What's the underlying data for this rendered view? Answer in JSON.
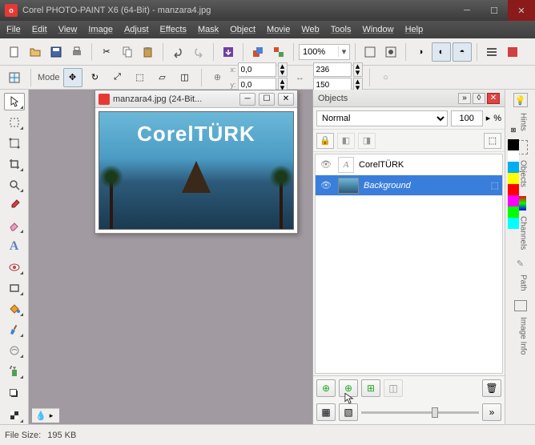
{
  "app": {
    "title": "Corel PHOTO-PAINT X6 (64-Bit) - manzara4.jpg",
    "icon_label": "o"
  },
  "menu": [
    "File",
    "Edit",
    "View",
    "Image",
    "Adjust",
    "Effects",
    "Mask",
    "Object",
    "Movie",
    "Web",
    "Tools",
    "Window",
    "Help"
  ],
  "zoom": "100%",
  "propbar": {
    "mode_label": "Mode",
    "pos": {
      "x": "0,0",
      "y": "0,0"
    },
    "size": {
      "w": "236",
      "h": "150"
    }
  },
  "doc": {
    "title": "manzara4.jpg (24-Bit...",
    "watermark": "CorelTÜRK"
  },
  "objects": {
    "title": "Objects",
    "blend": "Normal",
    "opacity": "100",
    "pct": "%",
    "items": [
      {
        "name": "CorelTÜRK",
        "type": "text",
        "selected": false
      },
      {
        "name": "Background",
        "type": "image",
        "selected": true
      }
    ]
  },
  "status": {
    "filesize_label": "File Size:",
    "filesize": "195 KB"
  },
  "righttabs": [
    "Hints",
    "Objects",
    "Channels",
    "Path",
    "Image Info"
  ],
  "colors": [
    "#000000",
    "#ffffff",
    "#00aeef",
    "#ffff00",
    "#ff0000",
    "#ff00ff",
    "#00ff00",
    "#00ffff"
  ]
}
